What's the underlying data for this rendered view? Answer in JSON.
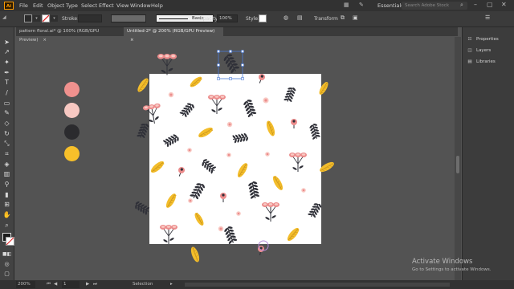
{
  "menubar": {
    "app_badge": "Ai",
    "items": [
      "File",
      "Edit",
      "Object",
      "Type",
      "Select",
      "Effect",
      "View",
      "Window",
      "Help"
    ],
    "workspace": "Essentials",
    "search_placeholder": "Search Adobe Stock"
  },
  "control_bar": {
    "stroke_label": "Stroke:",
    "brush_label": "Basic",
    "opacity_label": "Opacity:",
    "opacity_value": "100%",
    "style_label": "Style:",
    "transform_label": "Transform"
  },
  "tabs": [
    {
      "label": "pattern floral.ai* @ 100% (RGB/GPU Preview)",
      "active": false
    },
    {
      "label": "Untitled-2* @ 200% (RGB/GPU Preview)",
      "active": true
    }
  ],
  "panels": [
    {
      "label": "Properties",
      "icon": "properties-icon"
    },
    {
      "label": "Layers",
      "icon": "layers-icon"
    },
    {
      "label": "Libraries",
      "icon": "libraries-icon"
    }
  ],
  "palette_colors": [
    "#f0918e",
    "#f7c8c2",
    "#2b2b2e",
    "#f7c02a"
  ],
  "status": {
    "zoom": "200%",
    "page": "1",
    "tool": "Selection"
  },
  "watermark": {
    "line1": "Activate Windows",
    "line2": "Go to Settings to activate Windows."
  },
  "colors": {
    "pink": "#ec8c8c",
    "light_pink": "#f8c9c3",
    "dark": "#2f3038",
    "yellow": "#f3bd2b",
    "selection": "#4a7bd6",
    "accent": "#ff9a00"
  }
}
